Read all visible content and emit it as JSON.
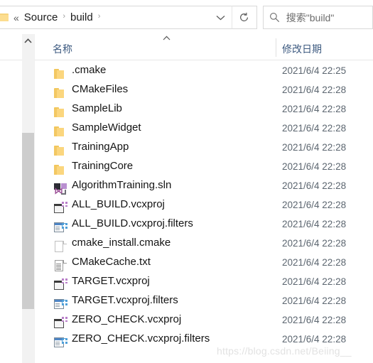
{
  "addressbar": {
    "back_chevrons": "«",
    "separator": "›",
    "crumbs": [
      "Source",
      "build"
    ],
    "folder_icon": "folder-icon",
    "dropdown_icon": "chevron-down-icon",
    "refresh_icon": "refresh-icon"
  },
  "search": {
    "icon": "search-icon",
    "placeholder": "搜索\"build\""
  },
  "columns": {
    "name": "名称",
    "date_modified": "修改日期",
    "sort_icon": "sort-ascending-caret-icon"
  },
  "scrollbar": {
    "up_arrow_icon": "scroll-up-arrow-icon"
  },
  "files": [
    {
      "name": ".cmake",
      "date": "2021/6/4 22:25",
      "icon": "folder-icon",
      "type": "folder"
    },
    {
      "name": "CMakeFiles",
      "date": "2021/6/4 22:28",
      "icon": "folder-icon",
      "type": "folder"
    },
    {
      "name": "SampleLib",
      "date": "2021/6/4 22:28",
      "icon": "folder-icon",
      "type": "folder"
    },
    {
      "name": "SampleWidget",
      "date": "2021/6/4 22:28",
      "icon": "folder-icon",
      "type": "folder"
    },
    {
      "name": "TrainingApp",
      "date": "2021/6/4 22:28",
      "icon": "folder-icon",
      "type": "folder"
    },
    {
      "name": "TrainingCore",
      "date": "2021/6/4 22:28",
      "icon": "folder-icon",
      "type": "folder"
    },
    {
      "name": "AlgorithmTraining.sln",
      "date": "2021/6/4 22:28",
      "icon": "visual-studio-solution-icon",
      "type": "sln"
    },
    {
      "name": "ALL_BUILD.vcxproj",
      "date": "2021/6/4 22:28",
      "icon": "vcxproj-icon",
      "type": "vcxproj"
    },
    {
      "name": "ALL_BUILD.vcxproj.filters",
      "date": "2021/6/4 22:28",
      "icon": "vcxproj-filters-icon",
      "type": "filters"
    },
    {
      "name": "cmake_install.cmake",
      "date": "2021/6/4 22:28",
      "icon": "blank-page-icon",
      "type": "page"
    },
    {
      "name": "CMakeCache.txt",
      "date": "2021/6/4 22:28",
      "icon": "text-document-icon",
      "type": "txt"
    },
    {
      "name": "TARGET.vcxproj",
      "date": "2021/6/4 22:28",
      "icon": "vcxproj-icon",
      "type": "vcxproj"
    },
    {
      "name": "TARGET.vcxproj.filters",
      "date": "2021/6/4 22:28",
      "icon": "vcxproj-filters-icon",
      "type": "filters"
    },
    {
      "name": "ZERO_CHECK.vcxproj",
      "date": "2021/6/4 22:28",
      "icon": "vcxproj-icon",
      "type": "vcxproj"
    },
    {
      "name": "ZERO_CHECK.vcxproj.filters",
      "date": "2021/6/4 22:28",
      "icon": "vcxproj-filters-icon",
      "type": "filters"
    }
  ],
  "watermark": "https://blog.csdn.net/Beiing__",
  "colors": {
    "folder": "#fbd67e",
    "header_text": "#3d5a80",
    "date_text": "#5c6670",
    "scrollbar_track": "#f2f2f2",
    "scrollbar_thumb": "#cdcdcd",
    "border": "#d9d9d9"
  }
}
